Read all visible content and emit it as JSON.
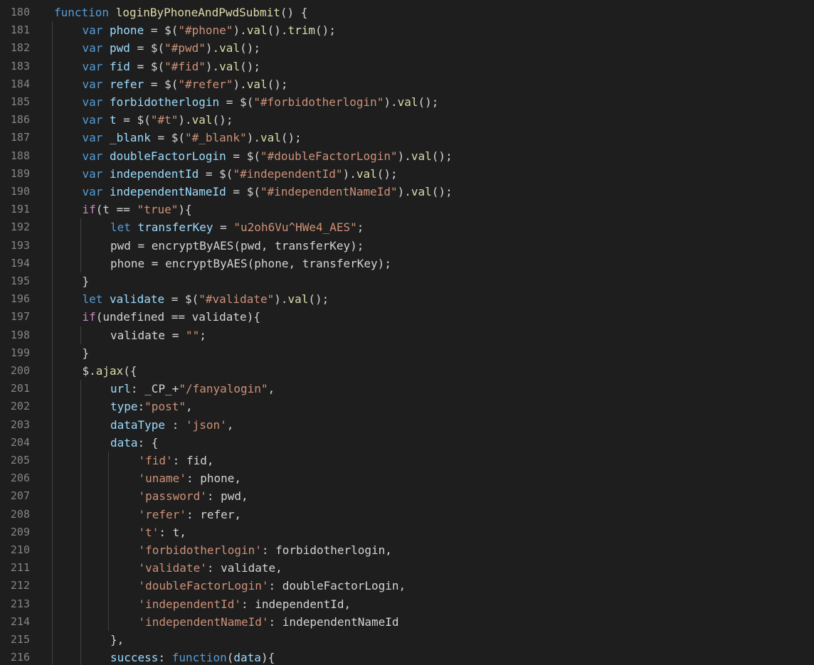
{
  "editor": {
    "theme": {
      "background": "#1e1e1e",
      "line_number": "#858585",
      "guide": "#404040"
    },
    "token_colors": {
      "kw": "#c586c0",
      "st": "#569cd6",
      "fn": "#dcdcaa",
      "var": "#9cdcfe",
      "str": "#ce9178",
      "txt": "#d4d4d4",
      "prop": "#9cdcfe"
    },
    "lines": [
      {
        "n": "180",
        "indent": 0,
        "tokens": [
          [
            "st",
            "function "
          ],
          [
            "fn",
            "loginByPhoneAndPwdSubmit"
          ],
          [
            "txt",
            "() {"
          ]
        ]
      },
      {
        "n": "181",
        "indent": 1,
        "tokens": [
          [
            "st",
            "var "
          ],
          [
            "var",
            "phone"
          ],
          [
            "txt",
            " = $("
          ],
          [
            "str",
            "\"#phone\""
          ],
          [
            "txt",
            ")."
          ],
          [
            "fn",
            "val"
          ],
          [
            "txt",
            "()."
          ],
          [
            "fn",
            "trim"
          ],
          [
            "txt",
            "();"
          ]
        ]
      },
      {
        "n": "182",
        "indent": 1,
        "tokens": [
          [
            "st",
            "var "
          ],
          [
            "var",
            "pwd"
          ],
          [
            "txt",
            " = $("
          ],
          [
            "str",
            "\"#pwd\""
          ],
          [
            "txt",
            ")."
          ],
          [
            "fn",
            "val"
          ],
          [
            "txt",
            "();"
          ]
        ]
      },
      {
        "n": "183",
        "indent": 1,
        "tokens": [
          [
            "st",
            "var "
          ],
          [
            "var",
            "fid"
          ],
          [
            "txt",
            " = $("
          ],
          [
            "str",
            "\"#fid\""
          ],
          [
            "txt",
            ")."
          ],
          [
            "fn",
            "val"
          ],
          [
            "txt",
            "();"
          ]
        ]
      },
      {
        "n": "184",
        "indent": 1,
        "tokens": [
          [
            "st",
            "var "
          ],
          [
            "var",
            "refer"
          ],
          [
            "txt",
            " = $("
          ],
          [
            "str",
            "\"#refer\""
          ],
          [
            "txt",
            ")."
          ],
          [
            "fn",
            "val"
          ],
          [
            "txt",
            "();"
          ]
        ]
      },
      {
        "n": "185",
        "indent": 1,
        "tokens": [
          [
            "st",
            "var "
          ],
          [
            "var",
            "forbidotherlogin"
          ],
          [
            "txt",
            " = $("
          ],
          [
            "str",
            "\"#forbidotherlogin\""
          ],
          [
            "txt",
            ")."
          ],
          [
            "fn",
            "val"
          ],
          [
            "txt",
            "();"
          ]
        ]
      },
      {
        "n": "186",
        "indent": 1,
        "tokens": [
          [
            "st",
            "var "
          ],
          [
            "var",
            "t"
          ],
          [
            "txt",
            " = $("
          ],
          [
            "str",
            "\"#t\""
          ],
          [
            "txt",
            ")."
          ],
          [
            "fn",
            "val"
          ],
          [
            "txt",
            "();"
          ]
        ]
      },
      {
        "n": "187",
        "indent": 1,
        "tokens": [
          [
            "st",
            "var "
          ],
          [
            "var",
            "_blank"
          ],
          [
            "txt",
            " = $("
          ],
          [
            "str",
            "\"#_blank\""
          ],
          [
            "txt",
            ")."
          ],
          [
            "fn",
            "val"
          ],
          [
            "txt",
            "();"
          ]
        ]
      },
      {
        "n": "188",
        "indent": 1,
        "tokens": [
          [
            "st",
            "var "
          ],
          [
            "var",
            "doubleFactorLogin"
          ],
          [
            "txt",
            " = $("
          ],
          [
            "str",
            "\"#doubleFactorLogin\""
          ],
          [
            "txt",
            ")."
          ],
          [
            "fn",
            "val"
          ],
          [
            "txt",
            "();"
          ]
        ]
      },
      {
        "n": "189",
        "indent": 1,
        "tokens": [
          [
            "st",
            "var "
          ],
          [
            "var",
            "independentId"
          ],
          [
            "txt",
            " = $("
          ],
          [
            "str",
            "\"#independentId\""
          ],
          [
            "txt",
            ")."
          ],
          [
            "fn",
            "val"
          ],
          [
            "txt",
            "();"
          ]
        ]
      },
      {
        "n": "190",
        "indent": 1,
        "tokens": [
          [
            "st",
            "var "
          ],
          [
            "var",
            "independentNameId"
          ],
          [
            "txt",
            " = $("
          ],
          [
            "str",
            "\"#independentNameId\""
          ],
          [
            "txt",
            ")."
          ],
          [
            "fn",
            "val"
          ],
          [
            "txt",
            "();"
          ]
        ]
      },
      {
        "n": "191",
        "indent": 1,
        "tokens": [
          [
            "kw",
            "if"
          ],
          [
            "txt",
            "(t == "
          ],
          [
            "str",
            "\"true\""
          ],
          [
            "txt",
            "){"
          ]
        ]
      },
      {
        "n": "192",
        "indent": 2,
        "tokens": [
          [
            "st",
            "let "
          ],
          [
            "var",
            "transferKey"
          ],
          [
            "txt",
            " = "
          ],
          [
            "str",
            "\"u2oh6Vu^HWe4_AES\""
          ],
          [
            "txt",
            ";"
          ]
        ]
      },
      {
        "n": "193",
        "indent": 2,
        "tokens": [
          [
            "txt",
            "pwd = encryptByAES(pwd, transferKey);"
          ]
        ]
      },
      {
        "n": "194",
        "indent": 2,
        "tokens": [
          [
            "txt",
            "phone = encryptByAES(phone, transferKey);"
          ]
        ]
      },
      {
        "n": "195",
        "indent": 1,
        "tokens": [
          [
            "txt",
            "}"
          ]
        ]
      },
      {
        "n": "196",
        "indent": 1,
        "tokens": [
          [
            "st",
            "let "
          ],
          [
            "var",
            "validate"
          ],
          [
            "txt",
            " = $("
          ],
          [
            "str",
            "\"#validate\""
          ],
          [
            "txt",
            ")."
          ],
          [
            "fn",
            "val"
          ],
          [
            "txt",
            "();"
          ]
        ]
      },
      {
        "n": "197",
        "indent": 1,
        "tokens": [
          [
            "kw",
            "if"
          ],
          [
            "txt",
            "(undefined == validate){"
          ]
        ]
      },
      {
        "n": "198",
        "indent": 2,
        "tokens": [
          [
            "txt",
            "validate = "
          ],
          [
            "str",
            "\"\""
          ],
          [
            "txt",
            ";"
          ]
        ]
      },
      {
        "n": "199",
        "indent": 1,
        "tokens": [
          [
            "txt",
            "}"
          ]
        ]
      },
      {
        "n": "200",
        "indent": 1,
        "tokens": [
          [
            "txt",
            "$."
          ],
          [
            "fn",
            "ajax"
          ],
          [
            "txt",
            "({"
          ]
        ]
      },
      {
        "n": "201",
        "indent": 2,
        "tokens": [
          [
            "prop",
            "url"
          ],
          [
            "txt",
            ": _CP_+"
          ],
          [
            "str",
            "\"/fanyalogin\""
          ],
          [
            "txt",
            ","
          ]
        ]
      },
      {
        "n": "202",
        "indent": 2,
        "tokens": [
          [
            "prop",
            "type"
          ],
          [
            "txt",
            ":"
          ],
          [
            "str",
            "\"post\""
          ],
          [
            "txt",
            ","
          ]
        ]
      },
      {
        "n": "203",
        "indent": 2,
        "tokens": [
          [
            "prop",
            "dataType"
          ],
          [
            "txt",
            " : "
          ],
          [
            "str",
            "'json'"
          ],
          [
            "txt",
            ","
          ]
        ]
      },
      {
        "n": "204",
        "indent": 2,
        "tokens": [
          [
            "prop",
            "data"
          ],
          [
            "txt",
            ": {"
          ]
        ]
      },
      {
        "n": "205",
        "indent": 3,
        "tokens": [
          [
            "str",
            "'fid'"
          ],
          [
            "txt",
            ": fid,"
          ]
        ]
      },
      {
        "n": "206",
        "indent": 3,
        "tokens": [
          [
            "str",
            "'uname'"
          ],
          [
            "txt",
            ": phone,"
          ]
        ]
      },
      {
        "n": "207",
        "indent": 3,
        "tokens": [
          [
            "str",
            "'password'"
          ],
          [
            "txt",
            ": pwd,"
          ]
        ]
      },
      {
        "n": "208",
        "indent": 3,
        "tokens": [
          [
            "str",
            "'refer'"
          ],
          [
            "txt",
            ": refer,"
          ]
        ]
      },
      {
        "n": "209",
        "indent": 3,
        "tokens": [
          [
            "str",
            "'t'"
          ],
          [
            "txt",
            ": t,"
          ]
        ]
      },
      {
        "n": "210",
        "indent": 3,
        "tokens": [
          [
            "str",
            "'forbidotherlogin'"
          ],
          [
            "txt",
            ": forbidotherlogin,"
          ]
        ]
      },
      {
        "n": "211",
        "indent": 3,
        "tokens": [
          [
            "str",
            "'validate'"
          ],
          [
            "txt",
            ": validate,"
          ]
        ]
      },
      {
        "n": "212",
        "indent": 3,
        "tokens": [
          [
            "str",
            "'doubleFactorLogin'"
          ],
          [
            "txt",
            ": doubleFactorLogin,"
          ]
        ]
      },
      {
        "n": "213",
        "indent": 3,
        "tokens": [
          [
            "str",
            "'independentId'"
          ],
          [
            "txt",
            ": independentId,"
          ]
        ]
      },
      {
        "n": "214",
        "indent": 3,
        "tokens": [
          [
            "str",
            "'independentNameId'"
          ],
          [
            "txt",
            ": independentNameId"
          ]
        ]
      },
      {
        "n": "215",
        "indent": 2,
        "tokens": [
          [
            "txt",
            "},"
          ]
        ]
      },
      {
        "n": "216",
        "indent": 2,
        "tokens": [
          [
            "prop",
            "success"
          ],
          [
            "txt",
            ": "
          ],
          [
            "st",
            "function"
          ],
          [
            "txt",
            "("
          ],
          [
            "var",
            "data"
          ],
          [
            "txt",
            "){"
          ]
        ]
      }
    ]
  }
}
